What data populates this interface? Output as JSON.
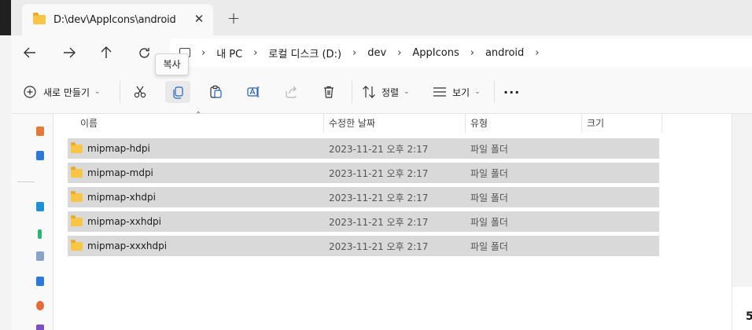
{
  "tab": {
    "title": "D:\\dev\\AppIcons\\android",
    "close": "✕",
    "new_tab": "+"
  },
  "nav": {
    "back": "←",
    "forward": "→",
    "up": "↑",
    "refresh": "↻"
  },
  "breadcrumb": [
    "내 PC",
    "로컬 디스크 (D:)",
    "dev",
    "AppIcons",
    "android"
  ],
  "breadcrumb_sep": "›",
  "tooltip": "복사",
  "toolbar": {
    "new_label": "새로 만들기",
    "sort_label": "정렬",
    "view_label": "보기",
    "more": "···"
  },
  "columns": {
    "name": "이름",
    "date": "수정한 날짜",
    "type": "유형",
    "size": "크기"
  },
  "files": [
    {
      "name": "mipmap-hdpi",
      "date": "2023-11-21 오후 2:17",
      "type": "파일 폴더"
    },
    {
      "name": "mipmap-mdpi",
      "date": "2023-11-21 오후 2:17",
      "type": "파일 폴더"
    },
    {
      "name": "mipmap-xhdpi",
      "date": "2023-11-21 오후 2:17",
      "type": "파일 폴더"
    },
    {
      "name": "mipmap-xxhdpi",
      "date": "2023-11-21 오후 2:17",
      "type": "파일 폴더"
    },
    {
      "name": "mipmap-xxxhdpi",
      "date": "2023-11-21 오후 2:17",
      "type": "파일 폴더"
    }
  ],
  "edge_text": "5",
  "colors": {
    "folder": "#f8c544",
    "selected_row": "#d9d9d9",
    "title_bar": "#ebebeb"
  }
}
